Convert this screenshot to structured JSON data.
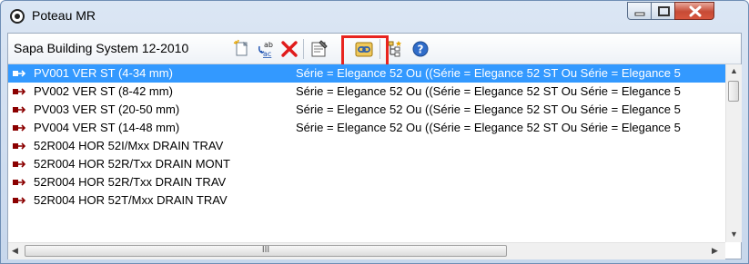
{
  "window": {
    "title": "Poteau MR"
  },
  "toolbar": {
    "system_label": "Sapa Building System 12-2010"
  },
  "rows": [
    {
      "name": "PV001 VER ST (4-34 mm)",
      "condition": "Série = Elegance 52 Ou ((Série = Elegance 52 ST Ou Série = Elegance 5",
      "selected": true
    },
    {
      "name": "PV002 VER ST (8-42 mm)",
      "condition": "Série = Elegance 52 Ou ((Série = Elegance 52 ST Ou Série = Elegance 5",
      "selected": false
    },
    {
      "name": "PV003 VER ST (20-50 mm)",
      "condition": "Série = Elegance 52 Ou ((Série = Elegance 52 ST Ou Série = Elegance 5",
      "selected": false
    },
    {
      "name": "PV004 VER ST (14-48 mm)",
      "condition": "Série = Elegance 52 Ou ((Série = Elegance 52 ST Ou Série = Elegance 5",
      "selected": false
    },
    {
      "name": "52R004 HOR 52I/Mxx DRAIN TRAV",
      "condition": "",
      "selected": false
    },
    {
      "name": "52R004 HOR 52R/Txx DRAIN MONT",
      "condition": "",
      "selected": false
    },
    {
      "name": "52R004 HOR 52R/Txx DRAIN TRAV",
      "condition": "",
      "selected": false
    },
    {
      "name": "52R004 HOR 52T/Mxx DRAIN TRAV",
      "condition": "",
      "selected": false
    }
  ],
  "scrollbar": {
    "grip": "III"
  },
  "colors": {
    "selection": "#3399ff",
    "highlight": "#e8241f",
    "row_icon": "#8b0000"
  },
  "icons": {
    "app": "app-circle-icon",
    "toolbar": [
      "new-item-icon",
      "rename-icon",
      "delete-icon",
      "properties-icon",
      "link-chain-icon",
      "filter-tree-icon",
      "help-icon"
    ]
  }
}
